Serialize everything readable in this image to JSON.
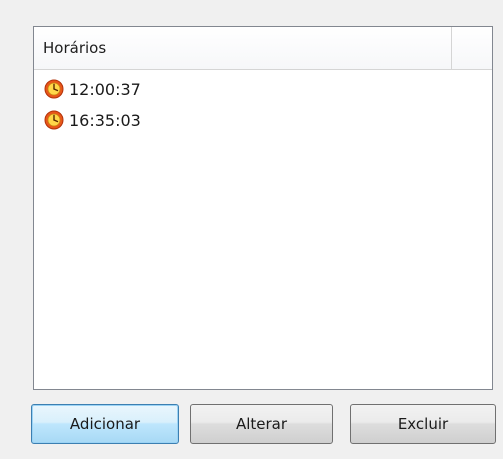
{
  "listview": {
    "column_header": "Horários",
    "rows": [
      {
        "time": "12:00:37",
        "icon": "clock-icon"
      },
      {
        "time": "16:35:03",
        "icon": "clock-icon"
      }
    ]
  },
  "buttons": {
    "add_label": "Adicionar",
    "edit_label": "Alterar",
    "delete_label": "Excluir"
  },
  "colors": {
    "icon_ring": "#e8561a",
    "icon_face": "#ffd84a",
    "default_button_border": "#3c7fb1"
  }
}
